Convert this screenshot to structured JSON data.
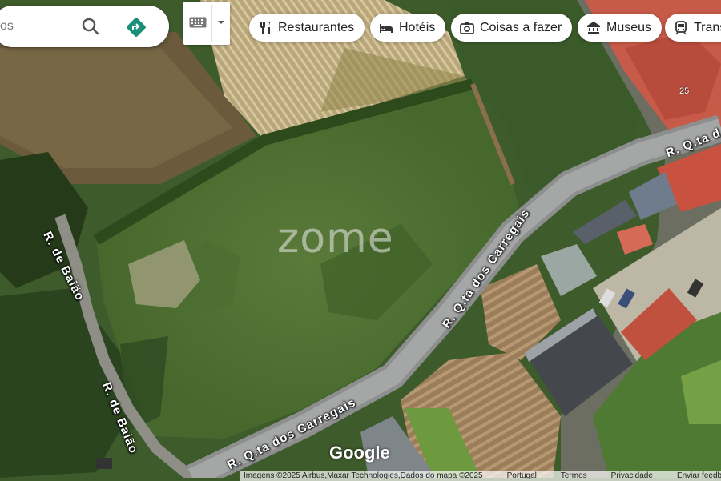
{
  "search": {
    "text": "os"
  },
  "chips": [
    {
      "label": "Restaurantes",
      "icon": "fork-knife-icon"
    },
    {
      "label": "Hotéis",
      "icon": "bed-icon"
    },
    {
      "label": "Coisas a fazer",
      "icon": "camera-icon"
    },
    {
      "label": "Museus",
      "icon": "museum-icon"
    },
    {
      "label": "Trans",
      "icon": "transit-icon"
    }
  ],
  "map": {
    "roads": [
      "R. de Baião",
      "R. de Baião",
      "R. Q.ta dos Carregais",
      "R. Q.ta dos Carregais",
      "R. Q.ta d"
    ],
    "house_number": "25",
    "watermark": "zome",
    "logo": "Google"
  },
  "attribution": [
    "Imagens ©2025 Airbus,Maxar Technologies,Dados do mapa ©2025",
    "Portugal",
    "Termos",
    "Privacidade",
    "Enviar feedback"
  ],
  "colors": {
    "accent": "#1a8f7a",
    "road": "#8a8a8a",
    "roof_red": "#c8523f"
  }
}
